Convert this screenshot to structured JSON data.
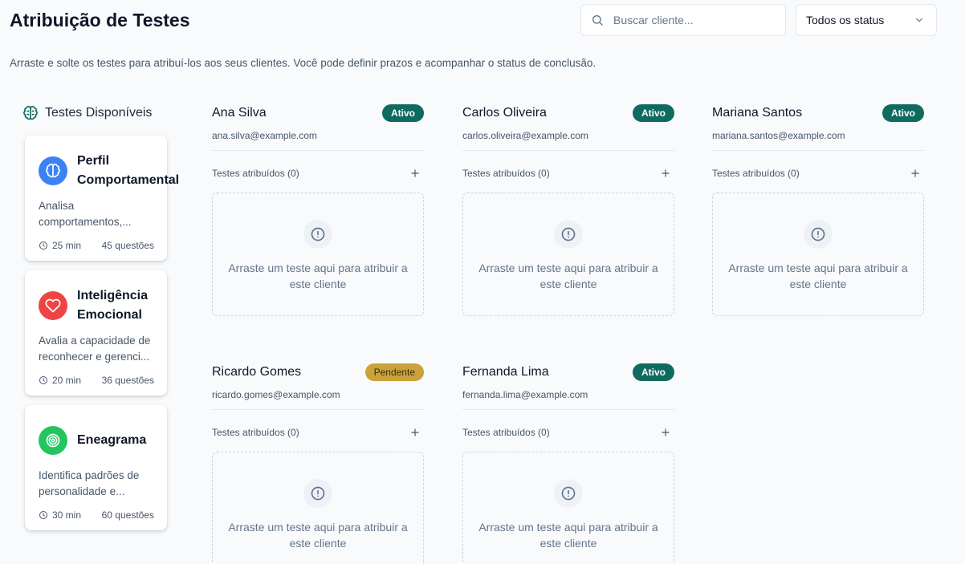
{
  "header": {
    "title": "Atribuição de Testes",
    "subtitle": "Arraste e solte os testes para atribuí-los aos seus clientes. Você pode definir prazos e acompanhar o status de conclusão.",
    "search_placeholder": "Buscar cliente...",
    "status_filter": "Todos os status"
  },
  "sidebar": {
    "title": "Testes Disponíveis",
    "tests": [
      {
        "name": "Perfil Comportamental",
        "description": "Analisa comportamentos,...",
        "duration": "25 min",
        "questions": "45 questões",
        "icon": "brain-icon",
        "color": "#3b82f6"
      },
      {
        "name": "Inteligência Emocional",
        "description": "Avalia a capacidade de reconhecer e gerenci...",
        "duration": "20 min",
        "questions": "36 questões",
        "icon": "heart-icon",
        "color": "#ef4444"
      },
      {
        "name": "Eneagrama",
        "description": "Identifica padrões de personalidade e...",
        "duration": "30 min",
        "questions": "60 questões",
        "icon": "target-icon",
        "color": "#22c55e"
      }
    ]
  },
  "clients": [
    {
      "name": "Ana Silva",
      "email": "ana.silva@example.com",
      "status": "Ativo",
      "assigned_label": "Testes atribuídos (0)",
      "dropzone_text": "Arraste um teste aqui para atribuir a este cliente"
    },
    {
      "name": "Carlos Oliveira",
      "email": "carlos.oliveira@example.com",
      "status": "Ativo",
      "assigned_label": "Testes atribuídos (0)",
      "dropzone_text": "Arraste um teste aqui para atribuir a este cliente"
    },
    {
      "name": "Mariana Santos",
      "email": "mariana.santos@example.com",
      "status": "Ativo",
      "assigned_label": "Testes atribuídos (0)",
      "dropzone_text": "Arraste um teste aqui para atribuir a este cliente"
    },
    {
      "name": "Ricardo Gomes",
      "email": "ricardo.gomes@example.com",
      "status": "Pendente",
      "assigned_label": "Testes atribuídos (0)",
      "dropzone_text": "Arraste um teste aqui para atribuir a este cliente"
    },
    {
      "name": "Fernanda Lima",
      "email": "fernanda.lima@example.com",
      "status": "Ativo",
      "assigned_label": "Testes atribuídos (0)",
      "dropzone_text": "Arraste um teste aqui para atribuir a este cliente"
    }
  ],
  "colors": {
    "active_badge": "#0f6b5f",
    "pending_badge": "#caa23a",
    "sidebar_icon": "#0f6b5f"
  }
}
